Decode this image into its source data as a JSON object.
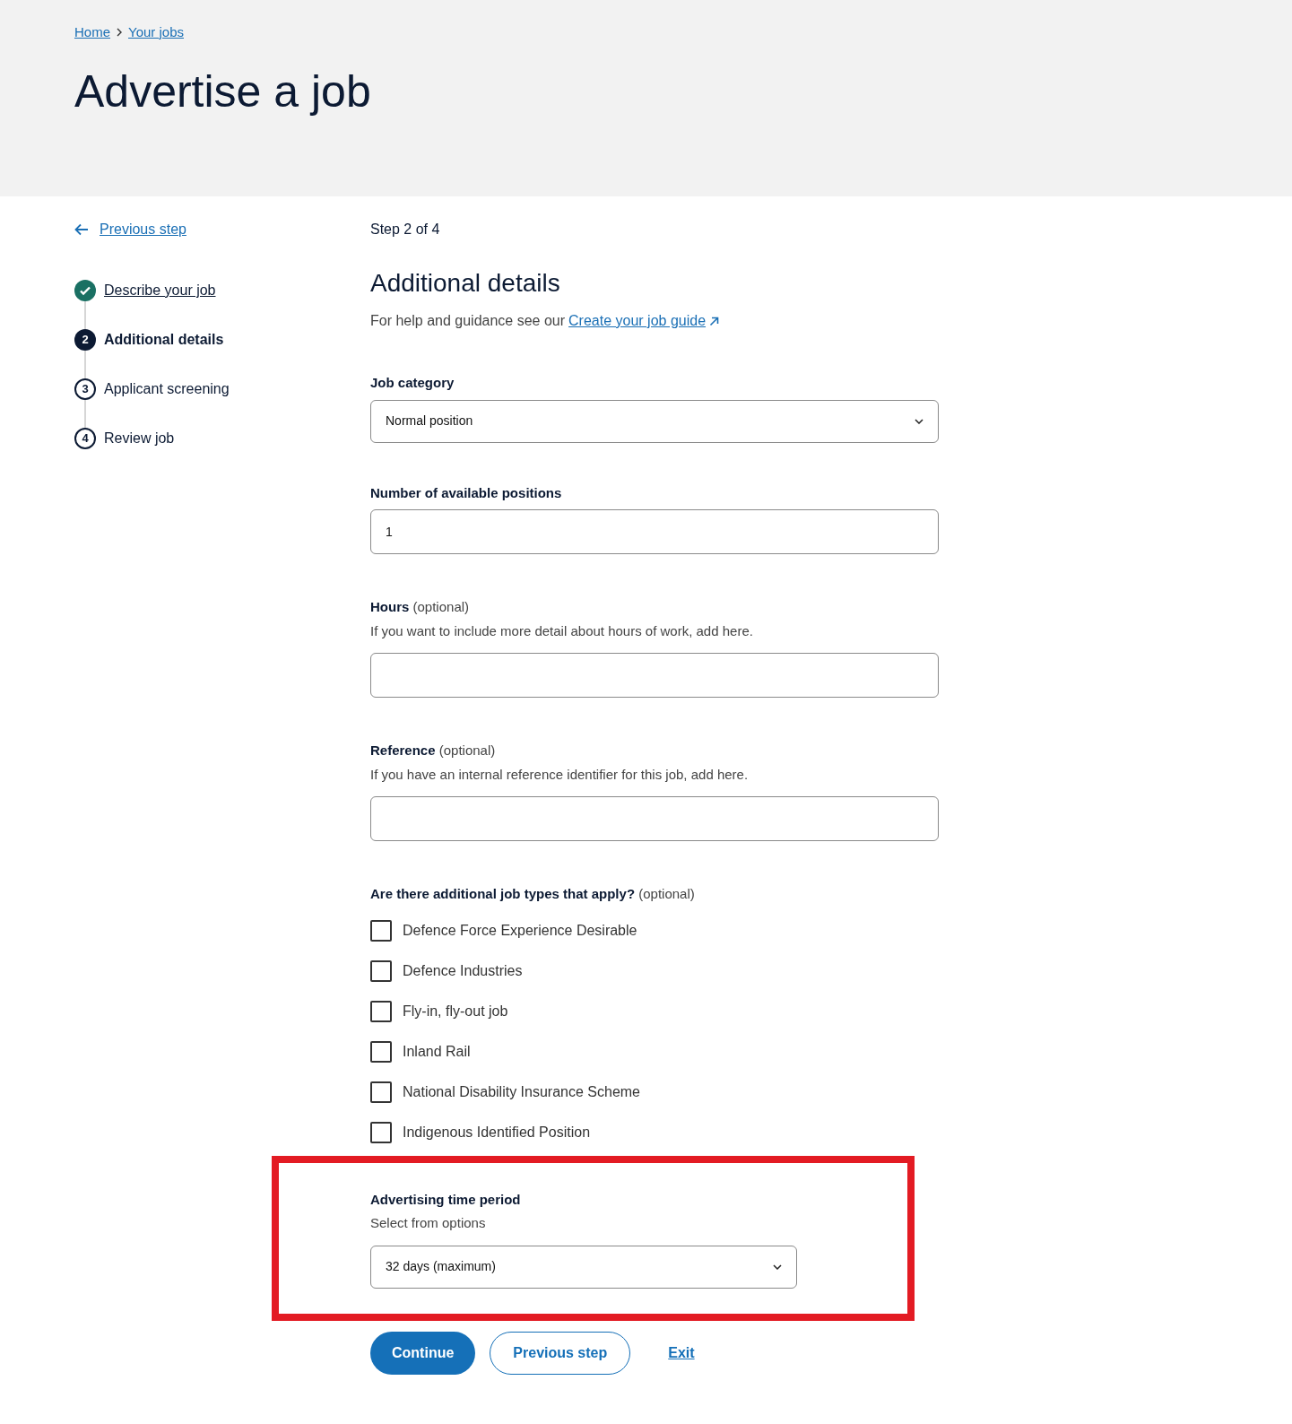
{
  "breadcrumbs": [
    {
      "label": "Home"
    },
    {
      "label": "Your jobs"
    }
  ],
  "page_title": "Advertise a job",
  "back_link": "Previous step",
  "steps": [
    {
      "label": "Describe your job",
      "completed": true,
      "selected": false
    },
    {
      "number": "2",
      "label": "Additional details",
      "completed": false,
      "selected": true
    },
    {
      "number": "3",
      "label": "Applicant screening",
      "completed": false,
      "selected": false
    },
    {
      "number": "4",
      "label": "Review job",
      "completed": false,
      "selected": false
    }
  ],
  "step_counter": "Step 2 of 4",
  "section_title": "Additional details",
  "help_text": "For help and guidance see our",
  "help_link": "Create your job guide",
  "job_category": {
    "label": "Job category",
    "value": "Normal position"
  },
  "positions": {
    "label": "Number of available positions",
    "value": "1"
  },
  "hours": {
    "label": "Hours",
    "optional": "(optional)",
    "hint": "If you want to include more detail about hours of work, add here."
  },
  "reference": {
    "label": "Reference",
    "optional": "(optional)",
    "hint": "If you have an internal reference identifier for this job, add here."
  },
  "job_types": {
    "label": "Are there additional job types that apply?",
    "optional": "(optional)",
    "options": [
      {
        "label": "Defence Force Experience Desirable",
        "checked": false
      },
      {
        "label": "Defence Industries",
        "checked": false
      },
      {
        "label": "Fly-in, fly-out job",
        "checked": false
      },
      {
        "label": "Inland Rail",
        "checked": false
      },
      {
        "label": "National Disability Insurance Scheme",
        "checked": false
      },
      {
        "label": "Indigenous Identified Position",
        "checked": false
      }
    ]
  },
  "advertising_period": {
    "label": "Advertising time period",
    "hint": "Select from options",
    "value": "32 days (maximum)",
    "highlighted": true
  },
  "buttons": {
    "primary": "Continue",
    "secondary": "Previous step",
    "link": "Exit"
  }
}
